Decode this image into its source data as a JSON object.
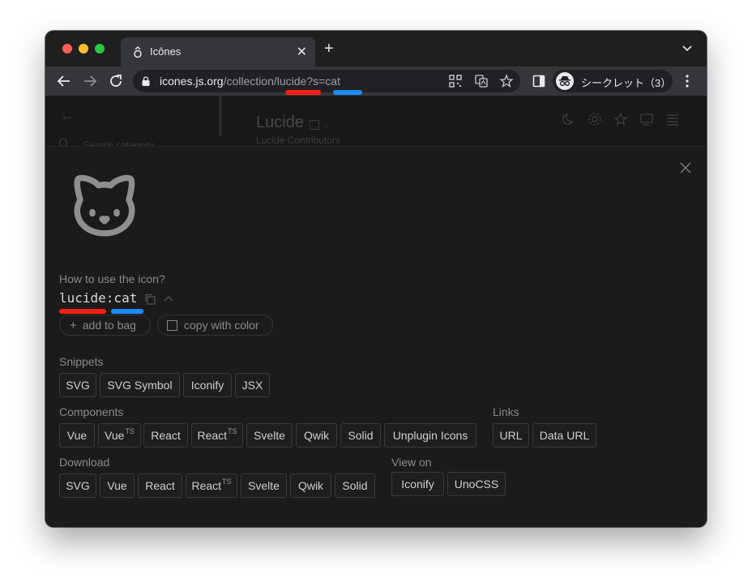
{
  "browser": {
    "tab_title": "Icônes",
    "url_host": "icones.js.org",
    "url_path": "/collection/lucide?s=cat",
    "profile_label": "シークレット（3）"
  },
  "background": {
    "title": "Lucide",
    "subtitle": "Lucide Contributors",
    "search_placeholder": "Search category"
  },
  "panel": {
    "how_to_use": "How to use the icon?",
    "icon_id": "lucide:cat",
    "add_to_bag": "add to bag",
    "copy_with_color": "copy with color"
  },
  "snippets": {
    "label": "Snippets",
    "items": [
      "SVG",
      "SVG Symbol",
      "Iconify",
      "JSX"
    ]
  },
  "components": {
    "label": "Components",
    "items": [
      {
        "text": "Vue",
        "sup": ""
      },
      {
        "text": "Vue",
        "sup": "TS"
      },
      {
        "text": "React",
        "sup": ""
      },
      {
        "text": "React",
        "sup": "TS"
      },
      {
        "text": "Svelte",
        "sup": ""
      },
      {
        "text": "Qwik",
        "sup": ""
      },
      {
        "text": "Solid",
        "sup": ""
      },
      {
        "text": "Unplugin Icons",
        "sup": ""
      }
    ]
  },
  "links": {
    "label": "Links",
    "items": [
      "URL",
      "Data URL"
    ]
  },
  "download": {
    "label": "Download",
    "items": [
      {
        "text": "SVG",
        "sup": ""
      },
      {
        "text": "Vue",
        "sup": ""
      },
      {
        "text": "React",
        "sup": ""
      },
      {
        "text": "React",
        "sup": "TS"
      },
      {
        "text": "Svelte",
        "sup": ""
      },
      {
        "text": "Qwik",
        "sup": ""
      },
      {
        "text": "Solid",
        "sup": ""
      }
    ]
  },
  "view_on": {
    "label": "View on",
    "items": [
      "Iconify",
      "UnoCSS"
    ]
  },
  "colors": {
    "annotation_red": "#ff1f0f",
    "annotation_blue": "#1a8cff",
    "panel_bg": "#1b1b1b"
  }
}
